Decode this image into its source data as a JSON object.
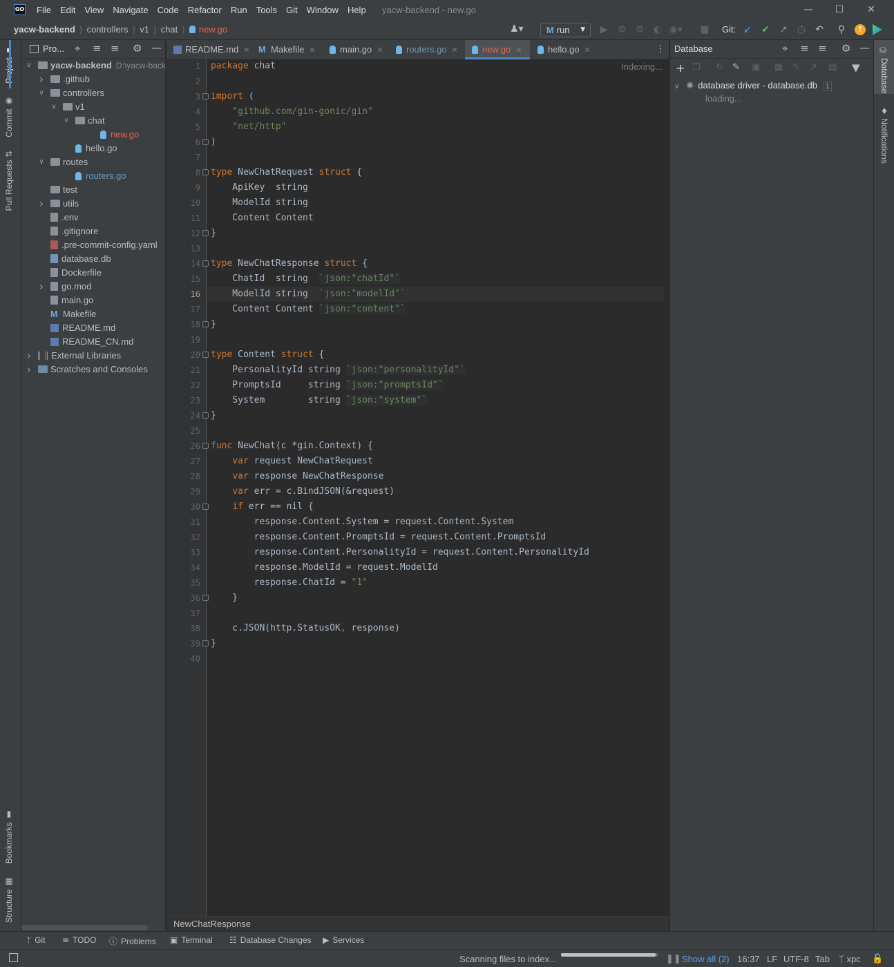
{
  "app": {
    "logo": "GO",
    "window_title": "yacw-backend - new.go",
    "menu": [
      "File",
      "Edit",
      "View",
      "Navigate",
      "Code",
      "Refactor",
      "Run",
      "Tools",
      "Git",
      "Window",
      "Help"
    ],
    "colors": {
      "background": "#2b2b2b",
      "panel": "#3c3f41",
      "accent": "#4a88c7",
      "modified_file": "#e8624f",
      "keyword": "#cc7832",
      "string": "#6a8759"
    }
  },
  "navbar": {
    "breadcrumb": [
      "yacw-backend",
      "controllers",
      "v1",
      "chat",
      "new.go"
    ],
    "run_config": "run",
    "git_label": "Git:"
  },
  "left_stripe": {
    "top_tabs": [
      "Project",
      "Commit",
      "Pull Requests"
    ],
    "bottom_tabs": [
      "Bookmarks",
      "Structure"
    ]
  },
  "project": {
    "header": "Pro...",
    "root_path": "D:\\yacw-back",
    "tree": [
      {
        "label": "yacw-backend",
        "kind": "root",
        "depth": 0,
        "arrow": "open"
      },
      {
        "label": ".github",
        "kind": "folder",
        "depth": 1,
        "arrow": "closed"
      },
      {
        "label": "controllers",
        "kind": "folder",
        "depth": 1,
        "arrow": "open"
      },
      {
        "label": "v1",
        "kind": "folder",
        "depth": 2,
        "arrow": "open"
      },
      {
        "label": "chat",
        "kind": "folder",
        "depth": 3,
        "arrow": "open"
      },
      {
        "label": "new.go",
        "kind": "go",
        "depth": 4,
        "arrow": "none",
        "status": "modified"
      },
      {
        "label": "hello.go",
        "kind": "go",
        "depth": 2,
        "arrow": "none"
      },
      {
        "label": "routes",
        "kind": "folder",
        "depth": 1,
        "arrow": "open"
      },
      {
        "label": "routers.go",
        "kind": "go",
        "depth": 2,
        "arrow": "none",
        "status": "changed"
      },
      {
        "label": "test",
        "kind": "folder",
        "depth": 1,
        "arrow": "none"
      },
      {
        "label": "utils",
        "kind": "folder",
        "depth": 1,
        "arrow": "closed"
      },
      {
        "label": ".env",
        "kind": "file",
        "depth": 1,
        "arrow": "none"
      },
      {
        "label": ".gitignore",
        "kind": "file",
        "depth": 1,
        "arrow": "none"
      },
      {
        "label": ".pre-commit-config.yaml",
        "kind": "yaml",
        "depth": 1,
        "arrow": "none"
      },
      {
        "label": "database.db",
        "kind": "db",
        "depth": 1,
        "arrow": "none"
      },
      {
        "label": "Dockerfile",
        "kind": "file",
        "depth": 1,
        "arrow": "none"
      },
      {
        "label": "go.mod",
        "kind": "file",
        "depth": 1,
        "arrow": "closed"
      },
      {
        "label": "main.go",
        "kind": "file",
        "depth": 1,
        "arrow": "none"
      },
      {
        "label": "Makefile",
        "kind": "make",
        "depth": 1,
        "arrow": "none"
      },
      {
        "label": "README.md",
        "kind": "md",
        "depth": 1,
        "arrow": "none"
      },
      {
        "label": "README_CN.md",
        "kind": "md",
        "depth": 1,
        "arrow": "none"
      },
      {
        "label": "External Libraries",
        "kind": "lib",
        "depth": 0,
        "arrow": "closed"
      },
      {
        "label": "Scratches and Consoles",
        "kind": "scratch",
        "depth": 0,
        "arrow": "closed"
      }
    ]
  },
  "editor": {
    "tabs": [
      {
        "label": "README.md",
        "icon": "markdown-icon",
        "active": false,
        "status": "normal"
      },
      {
        "label": "Makefile",
        "icon": "makefile-icon",
        "active": false,
        "status": "normal"
      },
      {
        "label": "main.go",
        "icon": "go-file-icon",
        "active": false,
        "status": "normal"
      },
      {
        "label": "routers.go",
        "icon": "go-file-icon",
        "active": false,
        "status": "changed"
      },
      {
        "label": "new.go",
        "icon": "go-file-icon",
        "active": true,
        "status": "modified"
      },
      {
        "label": "hello.go",
        "icon": "go-file-icon",
        "active": false,
        "status": "normal"
      }
    ],
    "indexing_label": "Indexing...",
    "current_line": 16,
    "fold_lines": [
      3,
      6,
      8,
      12,
      14,
      18,
      20,
      24,
      26,
      30,
      36,
      39
    ],
    "lines": [
      [
        [
          "kw",
          "package"
        ],
        [
          "p",
          " chat"
        ]
      ],
      [],
      [
        [
          "kw",
          "import"
        ],
        [
          "p",
          " ("
        ]
      ],
      [
        [
          "p",
          "    "
        ],
        [
          "str",
          "\"github.com/gin-gonic/gin\""
        ]
      ],
      [
        [
          "p",
          "    "
        ],
        [
          "str",
          "\"net/http\""
        ]
      ],
      [
        [
          "p",
          ")"
        ]
      ],
      [],
      [
        [
          "kw",
          "type"
        ],
        [
          "p",
          " NewChatRequest "
        ],
        [
          "kw",
          "struct"
        ],
        [
          "p",
          " {"
        ]
      ],
      [
        [
          "p",
          "    ApiKey  string"
        ]
      ],
      [
        [
          "p",
          "    ModelId string"
        ]
      ],
      [
        [
          "p",
          "    Content Content"
        ]
      ],
      [
        [
          "p",
          "}"
        ]
      ],
      [],
      [
        [
          "kw",
          "type"
        ],
        [
          "p",
          " NewChatResponse "
        ],
        [
          "kw",
          "struct"
        ],
        [
          "p",
          " {"
        ]
      ],
      [
        [
          "p",
          "    ChatId  string  "
        ],
        [
          "tag",
          "`json:\"chatId\"`"
        ]
      ],
      [
        [
          "p",
          "    ModelId string  "
        ],
        [
          "tag",
          "`json:\"modelId\"`"
        ]
      ],
      [
        [
          "p",
          "    Content Content "
        ],
        [
          "tag",
          "`json:\"content\"`"
        ]
      ],
      [
        [
          "p",
          "}"
        ]
      ],
      [],
      [
        [
          "kw",
          "type"
        ],
        [
          "p",
          " Content "
        ],
        [
          "kw",
          "struct"
        ],
        [
          "p",
          " {"
        ]
      ],
      [
        [
          "p",
          "    PersonalityId string "
        ],
        [
          "tag",
          "`json:\"personalityId\"`"
        ]
      ],
      [
        [
          "p",
          "    PromptsId     string "
        ],
        [
          "tag",
          "`json:\"promptsId\"`"
        ]
      ],
      [
        [
          "p",
          "    System        string "
        ],
        [
          "tag",
          "`json:\"system\"`"
        ]
      ],
      [
        [
          "p",
          "}"
        ]
      ],
      [],
      [
        [
          "kw",
          "func"
        ],
        [
          "p",
          " NewChat(c *gin.Context) {"
        ]
      ],
      [
        [
          "p",
          "    "
        ],
        [
          "kw",
          "var"
        ],
        [
          "p",
          " request NewChatRequest"
        ]
      ],
      [
        [
          "p",
          "    "
        ],
        [
          "kw",
          "var"
        ],
        [
          "p",
          " response NewChatResponse"
        ]
      ],
      [
        [
          "p",
          "    "
        ],
        [
          "kw",
          "var"
        ],
        [
          "p",
          " err = c.BindJSON(&request)"
        ]
      ],
      [
        [
          "p",
          "    "
        ],
        [
          "kw",
          "if"
        ],
        [
          "p",
          " err == nil {"
        ]
      ],
      [
        [
          "p",
          "        response.Content.System = request.Content.System"
        ]
      ],
      [
        [
          "p",
          "        response.Content.PromptsId = request.Content.PromptsId"
        ]
      ],
      [
        [
          "p",
          "        response.Content.PersonalityId = request.Content.PersonalityId"
        ]
      ],
      [
        [
          "p",
          "        response.ModelId = request.ModelId"
        ]
      ],
      [
        [
          "p",
          "        response.ChatId = "
        ],
        [
          "str",
          "\"1\""
        ]
      ],
      [
        [
          "p",
          "    }"
        ]
      ],
      [],
      [
        [
          "p",
          "    c.JSON(http.StatusOK"
        ],
        [
          "kw",
          ","
        ],
        [
          "p",
          " response)"
        ]
      ],
      [
        [
          "p",
          "}"
        ]
      ],
      []
    ],
    "breadcrumb": "NewChatResponse"
  },
  "database": {
    "title": "Database",
    "item_label": "database driver - database.db",
    "item_badge": "1",
    "loading": "loading..."
  },
  "right_stripe": {
    "tabs": [
      "Database",
      "Notifications"
    ]
  },
  "bottom_tabs": [
    "Git",
    "TODO",
    "Problems",
    "Terminal",
    "Database Changes",
    "Services"
  ],
  "status": {
    "task": "Scanning files to index...",
    "progress": 0.98,
    "show_all": "Show all (2)",
    "position": "16:37",
    "line_sep": "LF",
    "encoding": "UTF-8",
    "indent": "Tab",
    "branch": "xpc"
  }
}
